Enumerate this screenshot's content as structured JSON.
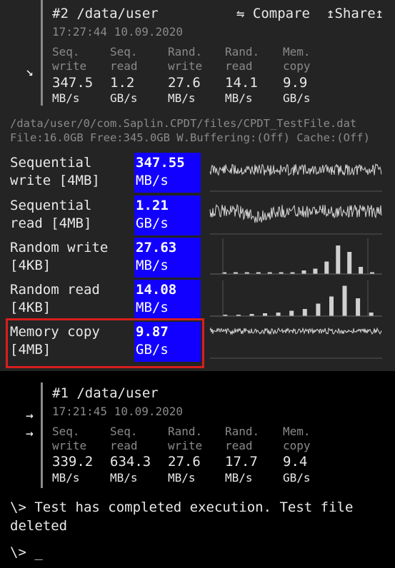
{
  "run2": {
    "title": "#2 /data/user",
    "timestamp": "17:27:44 10.09.2020",
    "compare_label": "⇋ Compare",
    "share_label": "↥Share↥",
    "metrics": [
      {
        "h1": "Seq.",
        "h2": "write",
        "value": "347.5",
        "unit": "MB/s"
      },
      {
        "h1": "Seq.",
        "h2": "read",
        "value": "1.2",
        "unit": "GB/s"
      },
      {
        "h1": "Rand.",
        "h2": "write",
        "value": "27.6",
        "unit": "MB/s"
      },
      {
        "h1": "Rand.",
        "h2": "read",
        "value": "14.1",
        "unit": "MB/s"
      },
      {
        "h1": "Mem.",
        "h2": "copy",
        "value": "9.9",
        "unit": "GB/s"
      }
    ]
  },
  "file_info": {
    "path": "/data/user/0/com.Saplin.CPDT/files/CPDT_TestFile.dat",
    "details": "File:16.0GB Free:345.0GB W.Buffering:(Off) Cache:(Off)"
  },
  "results": [
    {
      "label1": "Sequential",
      "label2": "write [4MB]",
      "value": "347.55",
      "unit": "MB/s"
    },
    {
      "label1": "Sequential",
      "label2": "read [4MB]",
      "value": "1.21",
      "unit": "GB/s"
    },
    {
      "label1": "Random write",
      "label2": "[4KB]",
      "value": "27.63",
      "unit": "MB/s"
    },
    {
      "label1": "Random read",
      "label2": "[4KB]",
      "value": "14.08",
      "unit": "MB/s"
    },
    {
      "label1": "Memory copy",
      "label2": "[4MB]",
      "value": "9.87",
      "unit": "GB/s"
    }
  ],
  "run1": {
    "title": "#1 /data/user",
    "timestamp": "17:21:45 10.09.2020",
    "metrics": [
      {
        "h1": "Seq.",
        "h2": "write",
        "value": "339.2",
        "unit": "MB/s"
      },
      {
        "h1": "Seq.",
        "h2": "read",
        "value": "634.3",
        "unit": "MB/s"
      },
      {
        "h1": "Rand.",
        "h2": "write",
        "value": "27.6",
        "unit": "MB/s"
      },
      {
        "h1": "Rand.",
        "h2": "read",
        "value": "17.7",
        "unit": "MB/s"
      },
      {
        "h1": "Mem.",
        "h2": "copy",
        "value": "9.4",
        "unit": "GB/s"
      }
    ]
  },
  "console": {
    "line1": "\\> Test has completed execution. Test file",
    "line2": "deleted",
    "prompt": "\\> _"
  },
  "chart_data": [
    {
      "type": "bar",
      "name": "Random write histogram",
      "values": [
        0.05,
        0.05,
        0.05,
        0.05,
        0.05,
        0.05,
        0.05,
        0.1,
        0.15,
        0.35,
        0.8,
        0.62,
        0.2,
        0.05
      ]
    },
    {
      "type": "bar",
      "name": "Random read histogram",
      "values": [
        0.04,
        0.04,
        0.06,
        0.08,
        0.1,
        0.15,
        0.2,
        0.35,
        0.55,
        0.85,
        0.5,
        0.1
      ]
    }
  ]
}
